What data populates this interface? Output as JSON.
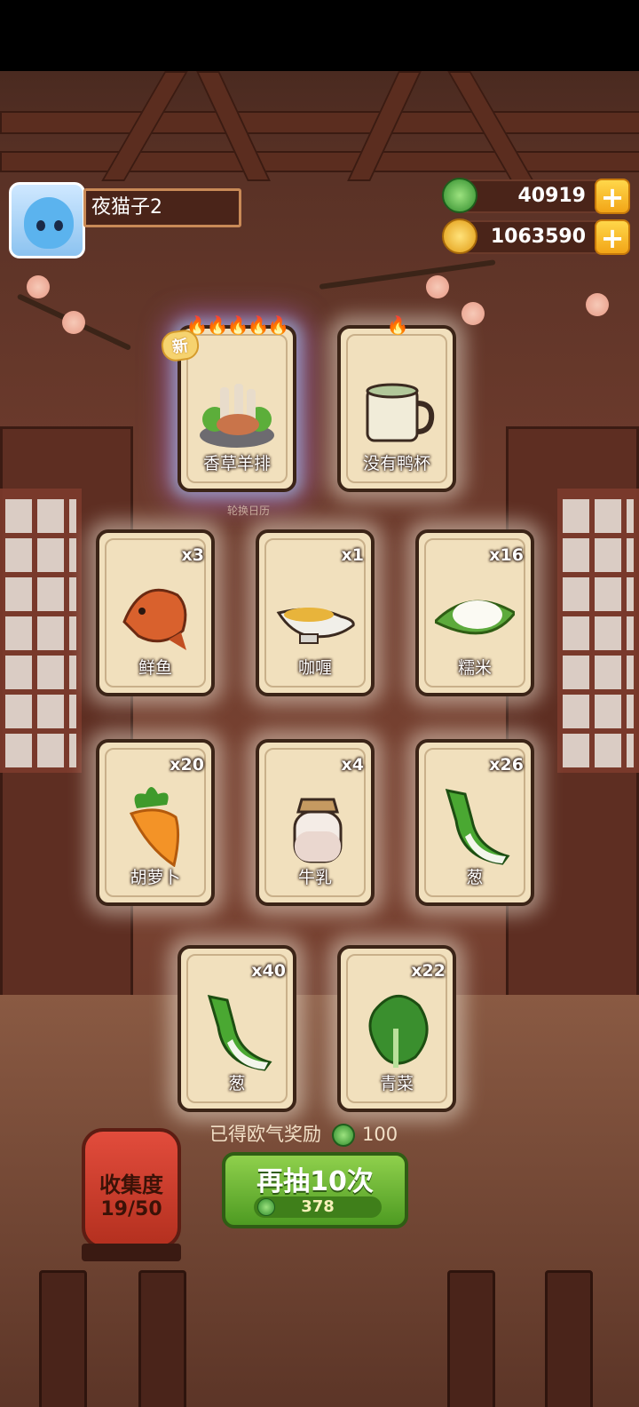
{
  "player": {
    "name": "夜猫子2"
  },
  "currencies": [
    {
      "value": "40919",
      "icon": "jade-icon",
      "color": "#3aa53a"
    },
    {
      "value": "1063590",
      "icon": "coin-icon",
      "color": "#f3b81e"
    }
  ],
  "subtitle": "轮换日历",
  "cards": [
    {
      "name": "香草羊排",
      "count": "",
      "flames": "🔥🔥🔥🔥🔥",
      "new": "新",
      "icon": "lamb-chops-icon"
    },
    {
      "name": "没有鸭杯",
      "count": "",
      "flames": "🔥",
      "new": "",
      "icon": "cup-icon"
    },
    {
      "name": "鲜鱼",
      "count": "x3",
      "icon": "fish-icon"
    },
    {
      "name": "咖喱",
      "count": "x1",
      "icon": "curry-icon"
    },
    {
      "name": "糯米",
      "count": "x16",
      "icon": "rice-icon"
    },
    {
      "name": "胡萝卜",
      "count": "x20",
      "icon": "carrot-icon"
    },
    {
      "name": "牛乳",
      "count": "x4",
      "icon": "milk-jar-icon"
    },
    {
      "name": "葱",
      "count": "x26",
      "icon": "scallion-icon"
    },
    {
      "name": "葱",
      "count": "x40",
      "icon": "scallion-icon"
    },
    {
      "name": "青菜",
      "count": "x22",
      "icon": "greens-icon"
    }
  ],
  "reward": {
    "label": "已得欧气奖励",
    "value": "100"
  },
  "collection": {
    "label": "收集度",
    "progress": "19/50"
  },
  "draw": {
    "label": "再抽10次",
    "cost": "378"
  }
}
